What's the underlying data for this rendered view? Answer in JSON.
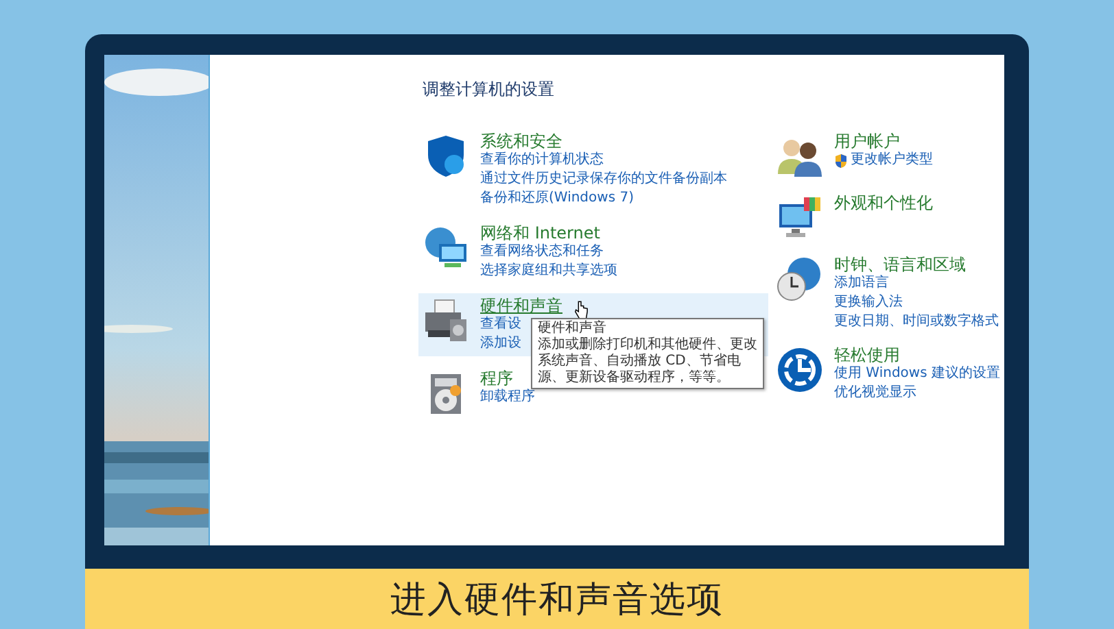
{
  "control_panel": {
    "heading": "调整计算机的设置",
    "left_categories": [
      {
        "kind": "shield",
        "title": "系统和安全",
        "selected": false,
        "links": [
          "查看你的计算机状态",
          "通过文件历史记录保存你的文件备份副本",
          "备份和还原(Windows 7)"
        ]
      },
      {
        "kind": "network",
        "title": "网络和 Internet",
        "selected": false,
        "links": [
          "查看网络状态和任务",
          "选择家庭组和共享选项"
        ]
      },
      {
        "kind": "printer",
        "title": "硬件和声音",
        "selected": true,
        "links": [
          "查看设",
          "添加设"
        ]
      },
      {
        "kind": "programs",
        "title": "程序",
        "selected": false,
        "links": [
          "卸载程序"
        ]
      }
    ],
    "right_categories": [
      {
        "kind": "users",
        "title": "用户帐户",
        "selected": false,
        "links": [
          "更改帐户类型"
        ]
      },
      {
        "kind": "display",
        "title": "外观和个性化",
        "selected": false
      },
      {
        "kind": "clock",
        "title": "时钟、语言和区域",
        "selected": false,
        "links": [
          "添加语言",
          "更换输入法",
          "更改日期、时间或数字格式"
        ]
      },
      {
        "kind": "ease",
        "title": "轻松使用",
        "selected": false,
        "links": [
          "使用 Windows 建议的设置",
          "优化视觉显示"
        ]
      }
    ],
    "tooltip": {
      "title": "硬件和声音",
      "text": "添加或删除打印机和其他硬件、更改系统声音、自动播放 CD、节省电源、更新设备驱动程序，等等。"
    }
  },
  "subtitle": "进入硬件和声音选项"
}
